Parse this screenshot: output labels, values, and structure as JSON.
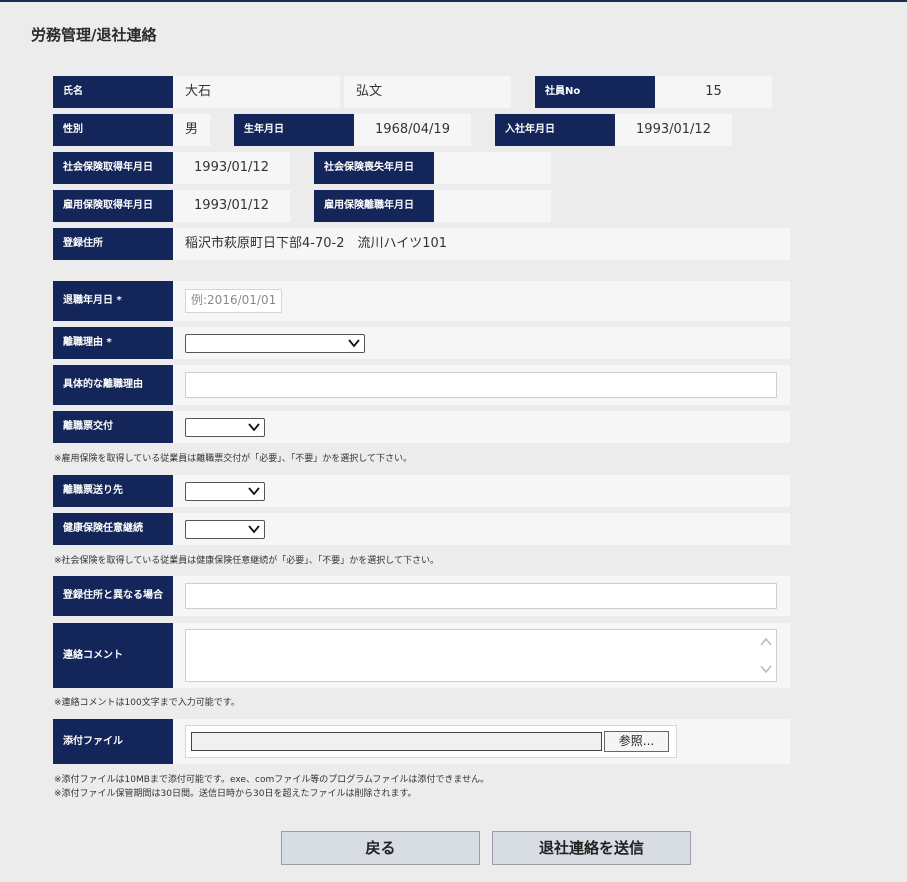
{
  "page": {
    "title": "労務管理/退社連絡"
  },
  "employee": {
    "name_label": "氏名",
    "last_name": "大石",
    "first_name": "弘文",
    "emp_no_label": "社員No",
    "emp_no": "15",
    "gender_label": "性別",
    "gender": "男",
    "birth_label": "生年月日",
    "birth_date": "1968/04/19",
    "join_label": "入社年月日",
    "join_date": "1993/01/12",
    "si_get_label": "社会保険取得年月日",
    "si_get_date": "1993/01/12",
    "si_loss_label": "社会保険喪失年月日",
    "si_loss_date": "",
    "ei_get_label": "雇用保険取得年月日",
    "ei_get_date": "1993/01/12",
    "ei_leave_label": "雇用保険離職年月日",
    "ei_leave_date": "",
    "address_label": "登録住所",
    "address": "稲沢市萩原町日下部4-70-2　流川ハイツ101"
  },
  "form": {
    "retire_date_label": "退職年月日 *",
    "retire_date_placeholder": "例:2016/01/01",
    "reason_label": "離職理由 *",
    "reason_value": "",
    "detail_reason_label": "具体的な離職理由",
    "detail_reason_value": "",
    "slip_label": "離職票交付",
    "slip_value": "",
    "note_slip": "※雇用保険を取得している従業員は離職票交付が「必要」、「不要」かを選択して下さい。",
    "slip_dest_label": "離職票送り先",
    "slip_dest_value": "",
    "health_label": "健康保険任意継続",
    "health_value": "",
    "note_health": "※社会保険を取得している従業員は健康保険任意継続が「必要」、「不要」かを選択して下さい。",
    "alt_address_label": "登録住所と異なる場合",
    "alt_address_value": "",
    "comment_label": "連絡コメント",
    "comment_value": "",
    "note_comment": "※連絡コメントは100文字まで入力可能です。",
    "attach_label": "添付ファイル",
    "attach_path": "",
    "browse_label": "参照...",
    "note_attach_1": "※添付ファイルは10MBまで添付可能です。exe、comファイル等のプログラムファイルは添付できません。",
    "note_attach_2": "※添付ファイル保管期間は30日間。送信日時から30日を超えたファイルは削除されます。"
  },
  "buttons": {
    "back": "戻る",
    "submit": "退社連絡を送信"
  },
  "colors": {
    "label_bg": "#142659",
    "value_bg": "#f6f6f6",
    "page_bg": "#ececec",
    "button_bg": "#d7dde3"
  },
  "icons": {
    "select_arrow": "chevron-down-icon",
    "scroll_up": "chevron-up-icon",
    "scroll_down": "chevron-down-icon"
  }
}
